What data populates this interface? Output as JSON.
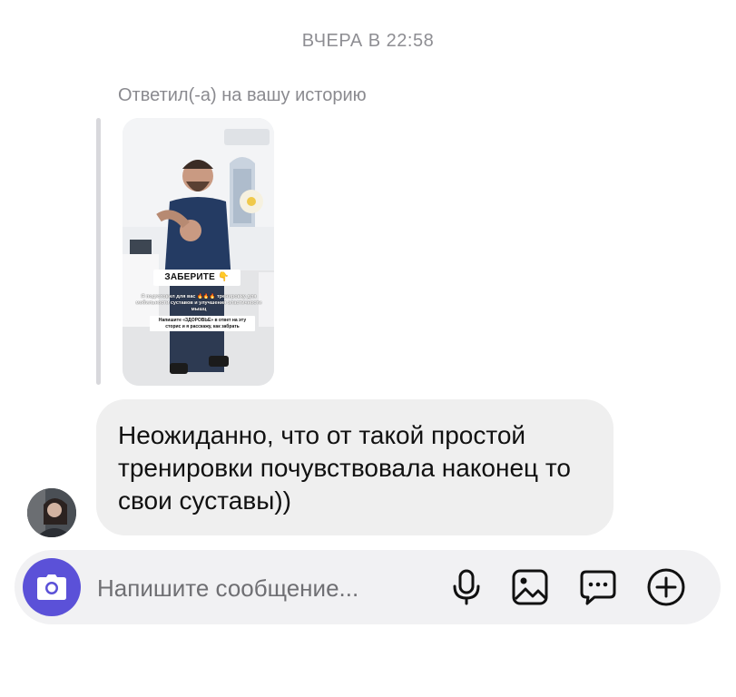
{
  "header": {
    "timestamp": "ВЧЕРА В 22:58"
  },
  "reply": {
    "caption": "Ответил(-а) на вашу историю",
    "story": {
      "title": "ЗАБЕРИТЕ 👇",
      "caption": "Я подготовил для вас 🔥🔥🔥 тренировку для мобильности суставов и улучшения эластичности мышц",
      "note": "Напишите «ЗДОРОВЬЕ» в ответ на эту сторис и я расскажу, как забрать"
    }
  },
  "message": {
    "text": "Неожиданно, что от такой простой тренировки почувствовала наконец то свои суставы))"
  },
  "composer": {
    "placeholder": "Напишите сообщение...",
    "icons": [
      "camera-icon",
      "microphone-icon",
      "image-icon",
      "sticker-chat-icon",
      "add-icon"
    ]
  },
  "colors": {
    "accent": "#5b51d8",
    "bubble": "#efefef",
    "muted_text": "#8e8e93"
  }
}
